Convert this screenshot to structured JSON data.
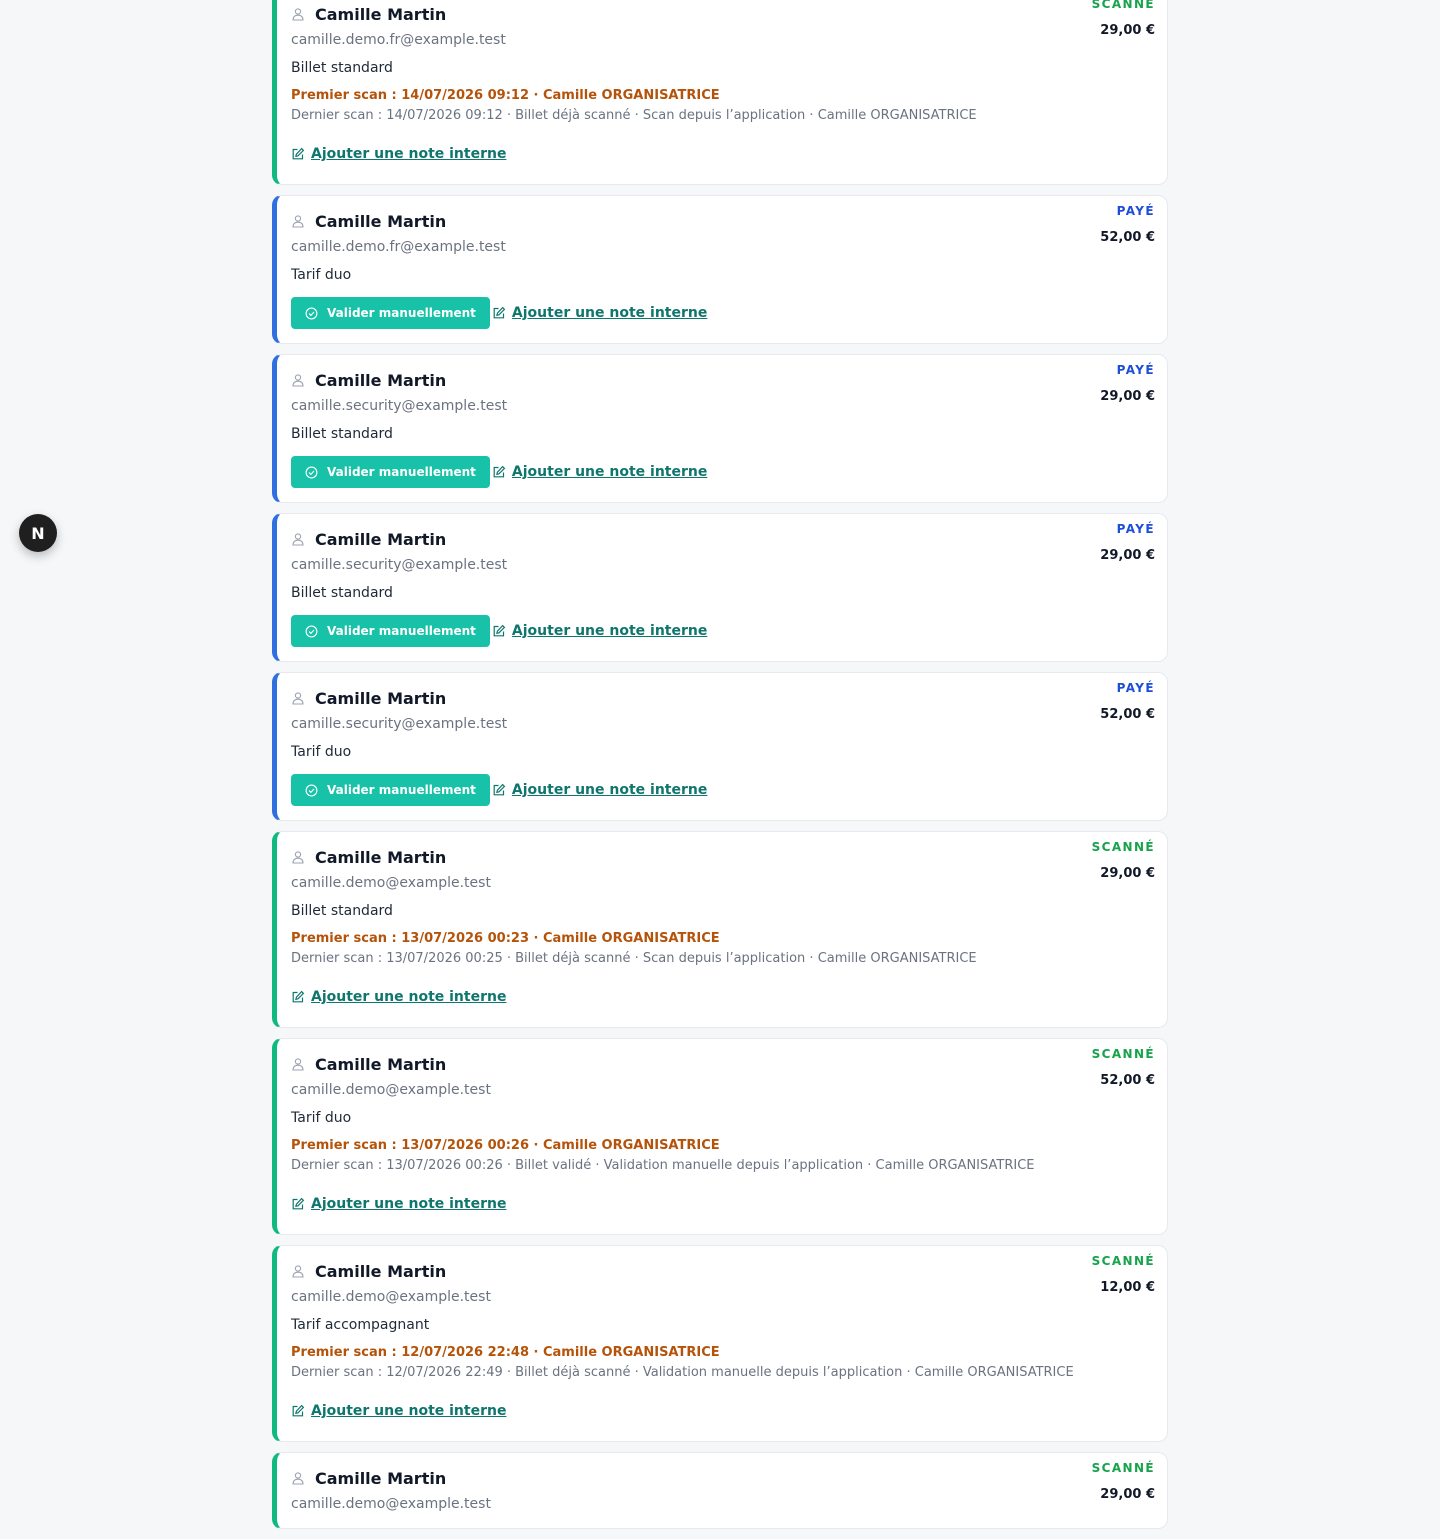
{
  "colors": {
    "scanned": "#16a34a",
    "paid": "#1d4ed8",
    "accent_button": "#17c2a8",
    "first_scan": "#b45309"
  },
  "fab": {
    "label": "N"
  },
  "cards": [
    {
      "status_type": "scanned",
      "status": "SCANNÉ",
      "price": "29,00 €",
      "name": "Camille Martin",
      "email": "camille.demo.fr@example.test",
      "ticket": "Billet standard",
      "first_scan": "Premier scan : 14/07/2026 09:12 · Camille ORGANISATRICE",
      "last_scan": "Dernier scan : 14/07/2026 09:12 · Billet déjà scanné · Scan depuis l’application · Camille ORGANISATRICE",
      "note_label": "Ajouter une note interne"
    },
    {
      "status_type": "paid",
      "status": "PAYÉ",
      "price": "52,00 €",
      "name": "Camille Martin",
      "email": "camille.demo.fr@example.test",
      "ticket": "Tarif duo",
      "validate_label": "Valider manuellement",
      "note_label": "Ajouter une note interne"
    },
    {
      "status_type": "paid",
      "status": "PAYÉ",
      "price": "29,00 €",
      "name": "Camille Martin",
      "email": "camille.security@example.test",
      "ticket": "Billet standard",
      "validate_label": "Valider manuellement",
      "note_label": "Ajouter une note interne"
    },
    {
      "status_type": "paid",
      "status": "PAYÉ",
      "price": "29,00 €",
      "name": "Camille Martin",
      "email": "camille.security@example.test",
      "ticket": "Billet standard",
      "validate_label": "Valider manuellement",
      "note_label": "Ajouter une note interne"
    },
    {
      "status_type": "paid",
      "status": "PAYÉ",
      "price": "52,00 €",
      "name": "Camille Martin",
      "email": "camille.security@example.test",
      "ticket": "Tarif duo",
      "validate_label": "Valider manuellement",
      "note_label": "Ajouter une note interne"
    },
    {
      "status_type": "scanned",
      "status": "SCANNÉ",
      "price": "29,00 €",
      "name": "Camille Martin",
      "email": "camille.demo@example.test",
      "ticket": "Billet standard",
      "first_scan": "Premier scan : 13/07/2026 00:23 · Camille ORGANISATRICE",
      "last_scan": "Dernier scan : 13/07/2026 00:25 · Billet déjà scanné · Scan depuis l’application · Camille ORGANISATRICE",
      "note_label": "Ajouter une note interne"
    },
    {
      "status_type": "scanned",
      "status": "SCANNÉ",
      "price": "52,00 €",
      "name": "Camille Martin",
      "email": "camille.demo@example.test",
      "ticket": "Tarif duo",
      "first_scan": "Premier scan : 13/07/2026 00:26 · Camille ORGANISATRICE",
      "last_scan": "Dernier scan : 13/07/2026 00:26 · Billet validé · Validation manuelle depuis l’application · Camille ORGANISATRICE",
      "note_label": "Ajouter une note interne"
    },
    {
      "status_type": "scanned",
      "status": "SCANNÉ",
      "price": "12,00 €",
      "name": "Camille Martin",
      "email": "camille.demo@example.test",
      "ticket": "Tarif accompagnant",
      "first_scan": "Premier scan : 12/07/2026 22:48 · Camille ORGANISATRICE",
      "last_scan": "Dernier scan : 12/07/2026 22:49 · Billet déjà scanné · Validation manuelle depuis l’application · Camille ORGANISATRICE",
      "note_label": "Ajouter une note interne"
    },
    {
      "status_type": "scanned",
      "status": "SCANNÉ",
      "price": "29,00 €",
      "name": "Camille Martin",
      "email": "camille.demo@example.test"
    }
  ]
}
